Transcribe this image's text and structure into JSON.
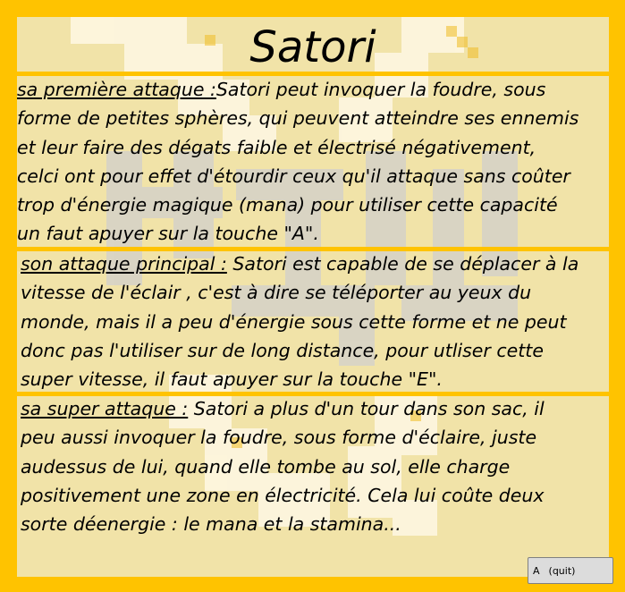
{
  "title": "Satori",
  "sections": [
    {
      "label": "sa première attaque :",
      "lines": [
        "Satori peut invoquer la foudre, sous",
        "forme de petites sphères, qui peuvent atteindre ses ennemis",
        "et leur faire des dégats faible et électrisé négativement,",
        "celci ont pour effet d'étourdir ceux qu'il attaque sans coûter",
        "trop d'énergie magique (mana) pour utiliser cette capacité",
        "un faut apuyer sur la touche \"A\"."
      ]
    },
    {
      "label": "son attaque principal :",
      "lines": [
        " Satori est capable de se déplacer à la",
        "vitesse de l'éclair  , c'est à dire se téléporter au yeux du",
        "monde, mais il a peu d'énergie sous cette forme et ne peut",
        "donc pas l'utiliser sur de long distance, pour utliser cette",
        "super vitesse, il faut apuyer sur la touche \"E\"."
      ]
    },
    {
      "label": "sa super attaque :",
      "lines": [
        " Satori a plus d'un tour dans son sac, il",
        "peu aussi invoquer la foudre, sous forme d'éclaire, juste",
        "audessus de lui, quand elle tombe au sol, elle charge",
        "positivement une zone en électricité. Cela lui coûte deux",
        "sorte déenergie : le mana et la stamina..."
      ]
    }
  ],
  "quit_button": {
    "key": "A",
    "label": "(quit)"
  },
  "colors": {
    "frame": "#ffc300",
    "panel": "#f1e3a8",
    "text": "#000000"
  }
}
